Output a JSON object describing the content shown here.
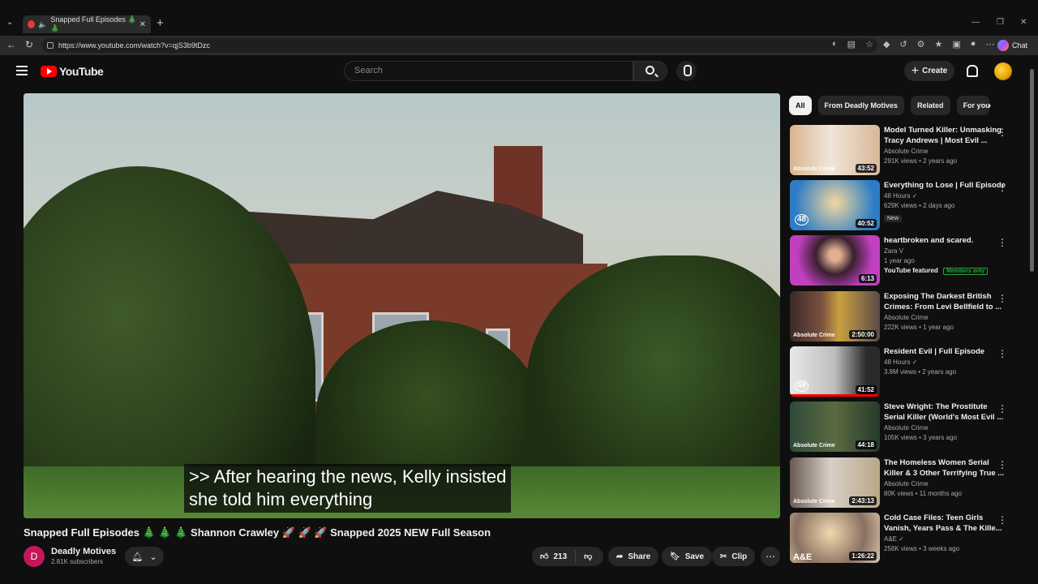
{
  "browser": {
    "tab_title": "Snapped Full Episodes 🎄 🎄",
    "url": "https://www.youtube.com/watch?v=qjS3b9tDzc",
    "chat_label": "Chat"
  },
  "header": {
    "logo_text": "YouTube",
    "search_placeholder": "Search",
    "create_label": "Create"
  },
  "player": {
    "caption_line1": ">> After hearing the news, Kelly insisted",
    "caption_line2": "she told him everything"
  },
  "video": {
    "title": "Snapped Full Episodes 🎄 🎄 🎄 Shannon Crawley 🚀 🚀 🚀 Snapped 2025 NEW Full Season",
    "channel": "Deadly Motives",
    "channel_initial": "D",
    "subscribers": "2.81K subscribers",
    "likes": "213",
    "share_label": "Share",
    "save_label": "Save",
    "clip_label": "Clip"
  },
  "chips": [
    "All",
    "From Deadly Motives",
    "Related",
    "For you"
  ],
  "recommendations": [
    {
      "title": "Model Turned Killer: Unmasking Tracy Andrews | Most Evil ...",
      "channel": "Absolute Crime",
      "stats": "291K views • 2 years ago",
      "duration": "43:52",
      "brand": "Absolute Crime",
      "extra": ""
    },
    {
      "title": "Everything to Lose | Full Episode",
      "channel": "48 Hours",
      "stats": "629K views • 2 days ago",
      "duration": "40:52",
      "brand": "48",
      "extra": "New"
    },
    {
      "title": "heartbroken and scared.",
      "channel": "Zara V",
      "stats": "1 year ago",
      "duration": "6:13",
      "brand": "",
      "extra": "YouTube featured",
      "members": "Members only"
    },
    {
      "title": "Exposing The Darkest British Crimes: From Levi Bellfield to ...",
      "channel": "Absolute Crime",
      "stats": "222K views • 1 year ago",
      "duration": "2:50:00",
      "brand": "Absolute Crime",
      "extra": ""
    },
    {
      "title": "Resident Evil | Full Episode",
      "channel": "48 Hours",
      "stats": "3.8M views • 2 years ago",
      "duration": "41:52",
      "brand": "48",
      "extra": ""
    },
    {
      "title": "Steve Wright: The Prostitute Serial Killer (World's Most Evil ...",
      "channel": "Absolute Crime",
      "stats": "105K views • 3 years ago",
      "duration": "44:18",
      "brand": "Absolute Crime",
      "extra": ""
    },
    {
      "title": "The Homeless Women Serial Killer & 3 Other Terrifying True ...",
      "channel": "Absolute Crime",
      "stats": "80K views • 11 months ago",
      "duration": "2:43:13",
      "brand": "Absolute Crime",
      "extra": ""
    },
    {
      "title": "Cold Case Files: Teen Girls Vanish, Years Pass & The Kille...",
      "channel": "A&E",
      "stats": "256K views • 3 weeks ago",
      "duration": "1:26:22",
      "brand": "A&E",
      "extra": ""
    }
  ],
  "colors": {
    "accent": "#ff0000",
    "bg": "#0f0f0f",
    "chip": "#272727"
  }
}
